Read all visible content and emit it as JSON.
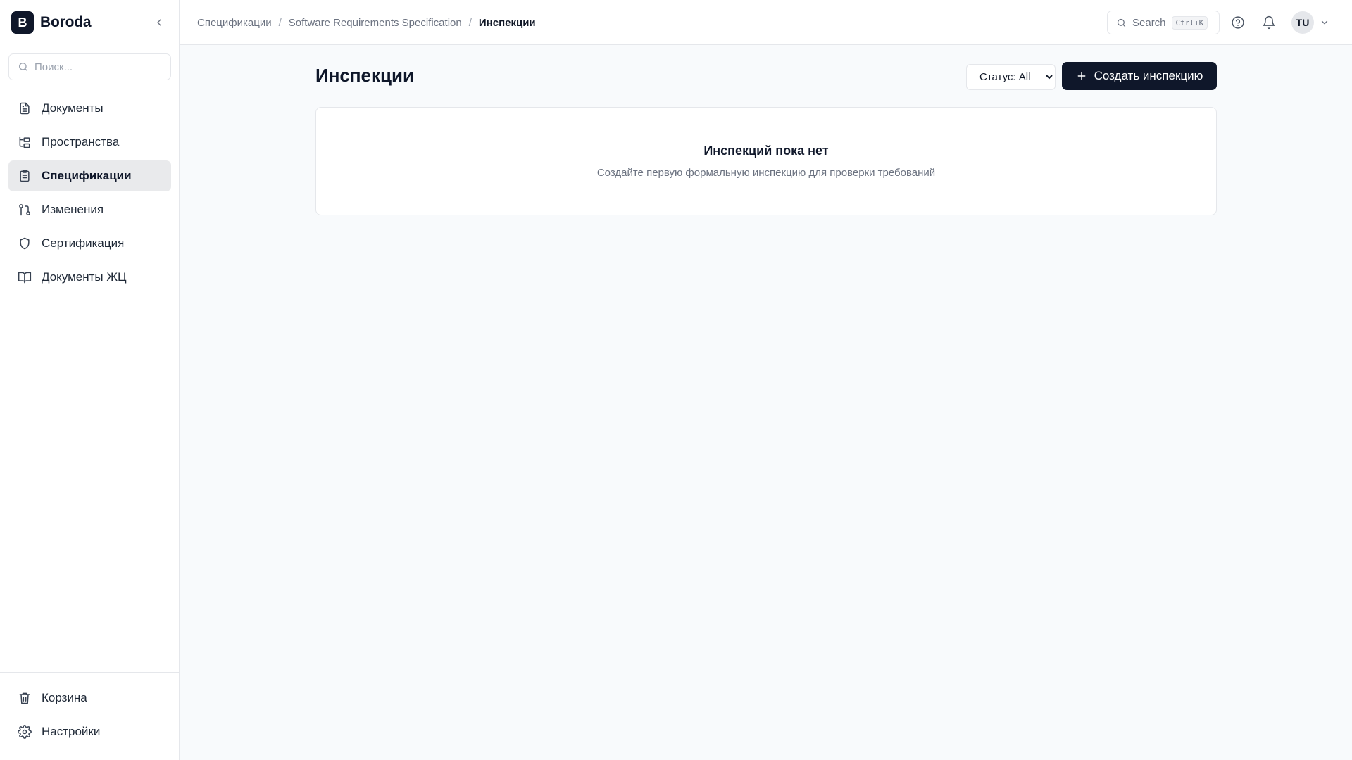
{
  "app": {
    "logo_letter": "B",
    "name": "Boroda"
  },
  "sidebar": {
    "search_placeholder": "Поиск...",
    "items": [
      {
        "label": "Документы",
        "icon": "document-icon"
      },
      {
        "label": "Пространства",
        "icon": "hierarchy-icon"
      },
      {
        "label": "Спецификации",
        "icon": "clipboard-icon",
        "active": true
      },
      {
        "label": "Изменения",
        "icon": "git-pull-request-icon"
      },
      {
        "label": "Сертификация",
        "icon": "shield-icon"
      },
      {
        "label": "Документы ЖЦ",
        "icon": "book-icon"
      }
    ],
    "bottom_items": [
      {
        "label": "Корзина",
        "icon": "trash-icon"
      },
      {
        "label": "Настройки",
        "icon": "gear-icon"
      }
    ]
  },
  "breadcrumb": {
    "items": [
      "Спецификации",
      "Software Requirements Specification"
    ],
    "separator": "/",
    "current": "Инспекции"
  },
  "topbar": {
    "search_label": "Search",
    "search_shortcut": "Ctrl+K",
    "user_initials": "TU"
  },
  "main": {
    "title": "Инспекции",
    "status_filter": {
      "selected": "Статус: All",
      "options": [
        "Статус: All"
      ]
    },
    "create_button_label": "Создать инспекцию",
    "empty_state": {
      "title": "Инспекций пока нет",
      "description": "Создайте первую формальную инспекцию для проверки требований"
    }
  },
  "colors": {
    "primary": "#0f172a",
    "background": "#f8fafc",
    "active_nav": "#e9eaec",
    "border": "#e5e7eb",
    "muted_text": "#6b7280"
  }
}
